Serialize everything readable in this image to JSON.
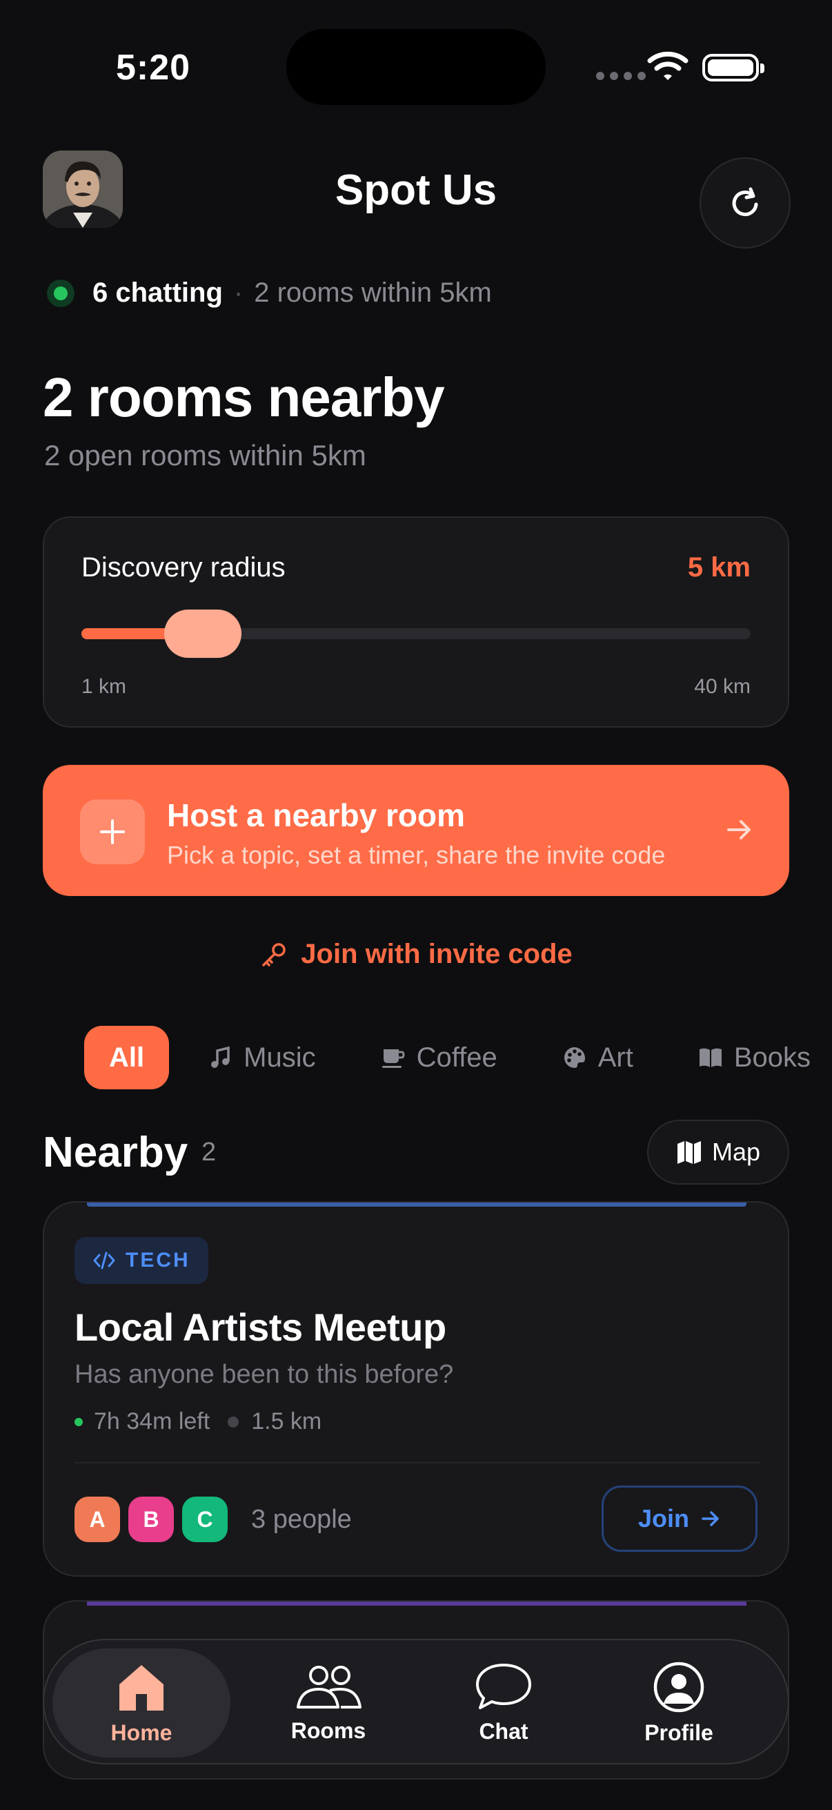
{
  "status_bar": {
    "time": "5:20"
  },
  "header": {
    "title": "Spot Us"
  },
  "presence": {
    "chatting": "6 chatting",
    "separator": "·",
    "rooms": "2 rooms within 5km"
  },
  "hero": {
    "title": "2 rooms nearby",
    "subtitle": "2 open rooms within 5km"
  },
  "radius": {
    "label": "Discovery radius",
    "value": "5 km",
    "min": "1 km",
    "max": "40 km",
    "current_km": 5,
    "min_km": 1,
    "max_km": 40
  },
  "host": {
    "title": "Host a nearby room",
    "subtitle": "Pick a topic, set a timer, share the invite code"
  },
  "invite": {
    "label": "Join with invite code"
  },
  "categories": [
    {
      "label": "All",
      "icon": "none",
      "active": true
    },
    {
      "label": "Music",
      "icon": "music-note-icon"
    },
    {
      "label": "Coffee",
      "icon": "coffee-cup-icon"
    },
    {
      "label": "Art",
      "icon": "palette-icon"
    },
    {
      "label": "Books",
      "icon": "book-icon"
    }
  ],
  "nearby": {
    "title": "Nearby",
    "count": "2",
    "map_label": "Map"
  },
  "rooms": [
    {
      "tag": "TECH",
      "title": "Local Artists Meetup",
      "description": "Has anyone been to this before?",
      "time_left": "7h 34m left",
      "distance": "1.5 km",
      "members": [
        "A",
        "B",
        "C"
      ],
      "people": "3 people",
      "join_label": "Join",
      "colors": {
        "accent": "#3a5fa8",
        "tag": "#4d8ef7"
      }
    }
  ],
  "tabs": [
    {
      "label": "Home",
      "icon": "home-icon",
      "active": true
    },
    {
      "label": "Rooms",
      "icon": "people-icon"
    },
    {
      "label": "Chat",
      "icon": "chat-bubble-icon"
    },
    {
      "label": "Profile",
      "icon": "profile-icon"
    }
  ],
  "colors": {
    "accent": "#ff6b45",
    "background": "#0e0e10",
    "card": "#18181b",
    "online": "#27c55e"
  }
}
